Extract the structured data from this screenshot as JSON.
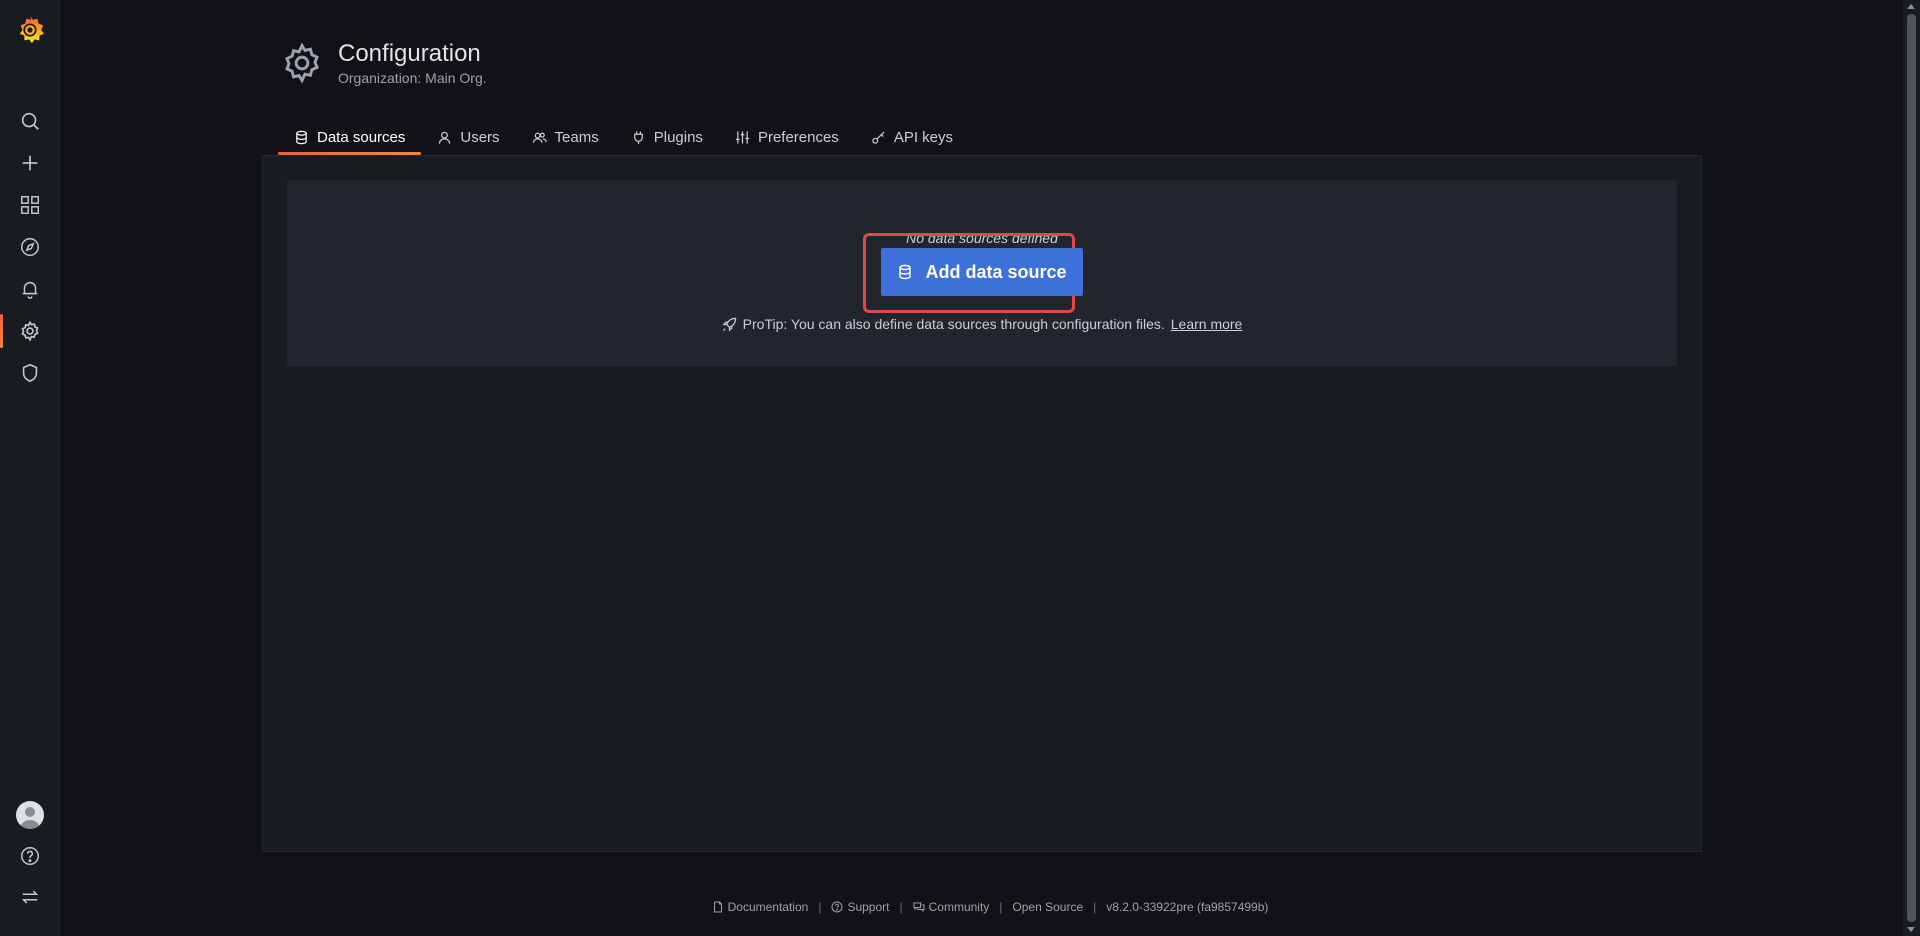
{
  "header": {
    "title": "Configuration",
    "subtitle": "Organization: Main Org."
  },
  "tabs": [
    {
      "label": "Data sources",
      "icon": "database-icon",
      "active": true
    },
    {
      "label": "Users",
      "icon": "user-icon",
      "active": false
    },
    {
      "label": "Teams",
      "icon": "users-icon",
      "active": false
    },
    {
      "label": "Plugins",
      "icon": "plug-icon",
      "active": false
    },
    {
      "label": "Preferences",
      "icon": "sliders-icon",
      "active": false
    },
    {
      "label": "API keys",
      "icon": "key-icon",
      "active": false
    }
  ],
  "sidemenu": {
    "items": [
      "grafana-logo",
      "search-icon",
      "plus-icon",
      "dashboards-icon",
      "explore-icon",
      "alerting-icon",
      "configuration-icon",
      "shield-icon",
      "avatar",
      "help-icon",
      "switch-icon"
    ],
    "active": "configuration-icon",
    "accent": "#f55f3e"
  },
  "empty_state": {
    "title": "No data sources defined",
    "button_label": "Add data source",
    "protip": "ProTip: You can also define data sources through configuration files.",
    "learn_more": "Learn more",
    "button_color": "#3d71d9",
    "highlight_color": "#e5454e"
  },
  "footer": {
    "documentation": "Documentation",
    "support": "Support",
    "community": "Community",
    "open_source": "Open Source",
    "version": "v8.2.0-33922pre (fa9857499b)",
    "separator": "|"
  }
}
